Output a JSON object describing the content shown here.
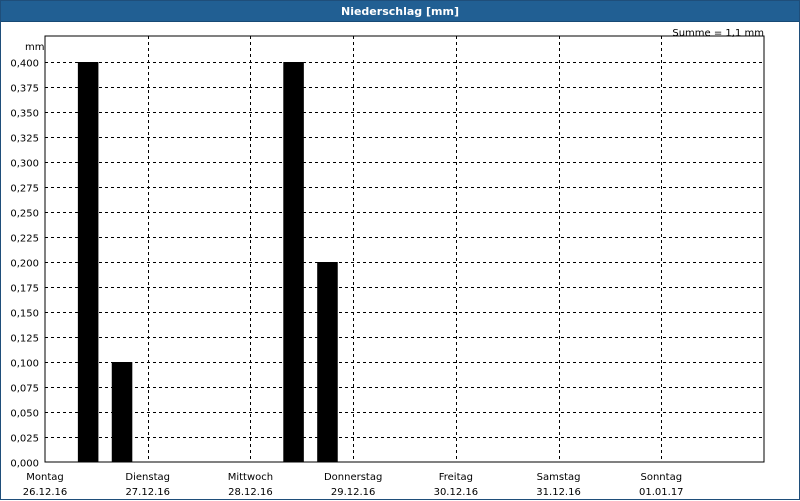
{
  "window": {
    "title": "Niederschlag [mm]"
  },
  "chart_data": {
    "type": "bar",
    "title": "Niederschlag [mm]",
    "ylabel": "mm",
    "summary": "Summe = 1,1 mm",
    "ylim": [
      0,
      0.4
    ],
    "yticks": [
      "0,000",
      "0,025",
      "0,050",
      "0,075",
      "0,100",
      "0,125",
      "0,150",
      "0,175",
      "0,200",
      "0,225",
      "0,250",
      "0,275",
      "0,300",
      "0,325",
      "0,350",
      "0,375",
      "0,400"
    ],
    "days": [
      {
        "name": "Montag",
        "date": "26.12.16"
      },
      {
        "name": "Dienstag",
        "date": "27.12.16"
      },
      {
        "name": "Mittwoch",
        "date": "28.12.16"
      },
      {
        "name": "Donnerstag",
        "date": "29.12.16"
      },
      {
        "name": "Freitag",
        "date": "30.12.16"
      },
      {
        "name": "Samstag",
        "date": "31.12.16"
      },
      {
        "name": "Sonntag",
        "date": "01.01.17"
      }
    ],
    "bars": [
      {
        "day": 0,
        "half": 0,
        "value": 0.4
      },
      {
        "day": 0,
        "half": 1,
        "value": 0.1
      },
      {
        "day": 2,
        "half": 0,
        "value": 0.4
      },
      {
        "day": 2,
        "half": 1,
        "value": 0.2
      }
    ],
    "grid": true,
    "bar_color": "#000000"
  }
}
